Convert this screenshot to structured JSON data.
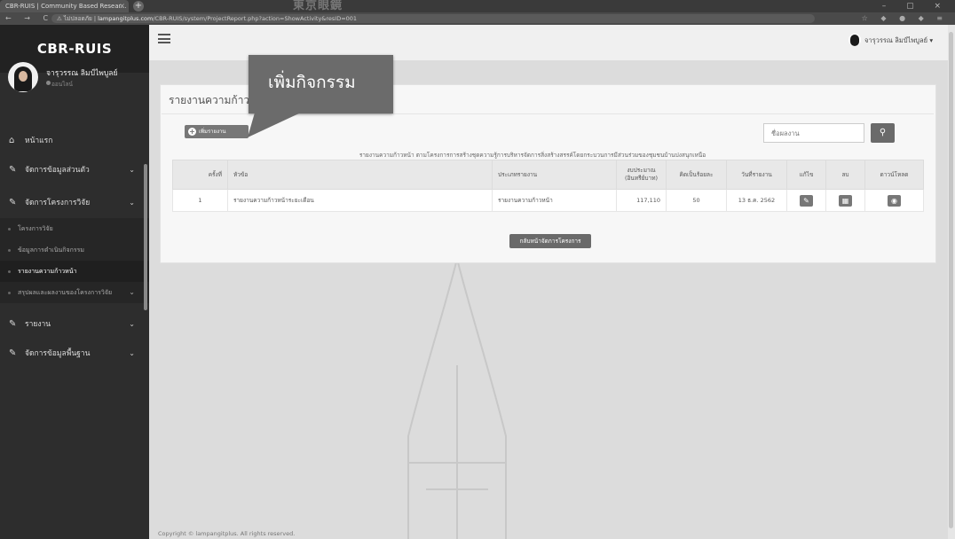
{
  "browser": {
    "tab_title": "CBR-RUIS | Community Based Resear...",
    "tab_close": "×",
    "new_tab": "+",
    "banner": "東京眼鏡",
    "url_warning": "ไม่ปลอดภัย",
    "url_host": "lampangitplus.com",
    "url_path": "/CBR-RUIS/system/ProjectReport.php?action=ShowActivity&resID=001",
    "nav": "← → C ⌂",
    "extensions": "☆ ◆ ● ◆ ≡",
    "window_controls": "– ▢ ×"
  },
  "sidebar": {
    "brand": "CBR-RUIS",
    "user_name": "จารุวรรณ ลิมป์ไพบูลย์",
    "user_status": "ออนไลน์",
    "items": [
      {
        "label": "หน้าแรก",
        "icon": "home-icon"
      },
      {
        "label": "จัดการข้อมูลส่วนตัว",
        "icon": "edit-icon"
      },
      {
        "label": "จัดการโครงการวิจัย",
        "icon": "edit-icon"
      },
      {
        "label": "รายงาน",
        "icon": "edit-icon"
      },
      {
        "label": "จัดการข้อมูลพื้นฐาน",
        "icon": "edit-icon"
      }
    ],
    "subitems": [
      {
        "label": "โครงการวิจัย"
      },
      {
        "label": "ข้อมูลการดำเนินกิจกรรม"
      },
      {
        "label": "รายงานความก้าวหน้า"
      },
      {
        "label": "สรุปผลและผลงานของโครงการวิจัย"
      }
    ]
  },
  "header": {
    "user_name": "จารุวรรณ ลิมป์ไพบูลย์ ▾"
  },
  "main": {
    "page_title": "รายงานความก้าวหน้า",
    "add_button": "เพิ่มรายงาน",
    "search_placeholder": "ชื่อผลงาน",
    "subtitle": "รายงานความก้าวหน้า ตามโครงการการสร้างชุดความรู้การบริหารจัดการสิ่งสร้างสรรค์โดยกระบวนการมีส่วนร่วมของชุมชนบ้านปงสนุกเหนือ",
    "table": {
      "headers": [
        "ครั้งที่",
        "หัวข้อ",
        "ประเภทรายงาน",
        "งบประมาณ (อินทรีย์บาท)",
        "คิดเป็นร้อยละ",
        "วันที่รายงาน",
        "แก้ไข",
        "ลบ",
        "ดาวน์โหลด"
      ],
      "rows": [
        [
          "1",
          "รายงานความก้าวหน้าระยะเดือน",
          "รายงานความก้าวหน้า",
          "117,110",
          "50",
          "13 ธ.ค. 2562"
        ]
      ]
    },
    "back_button": "กลับหน้าจัดการโครงการ",
    "footer": "Copyright © lampangitplus. All rights reserved."
  },
  "callout": {
    "text": "เพิ่มกิจกรรม"
  }
}
